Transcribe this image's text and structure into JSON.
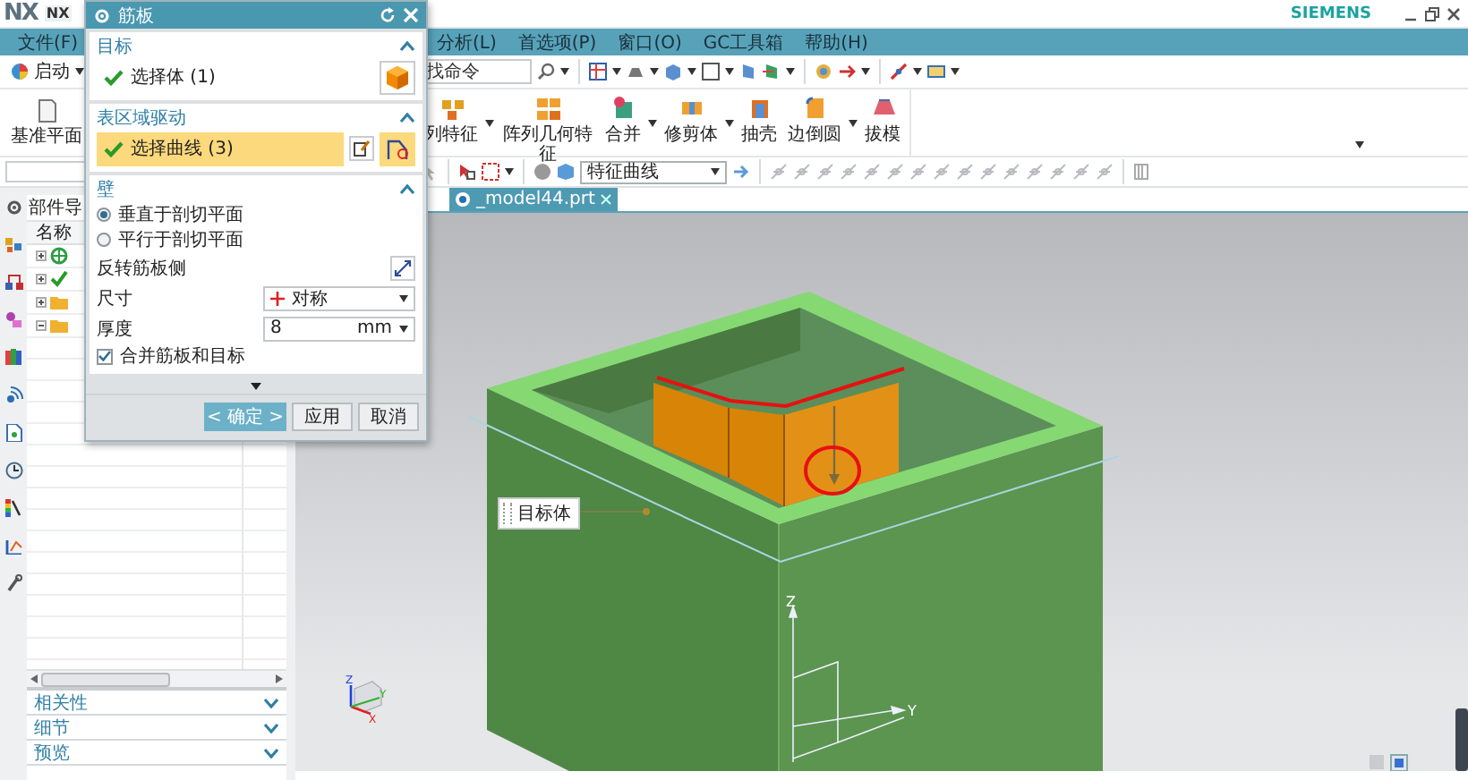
{
  "title_bar": {
    "logo": "NX",
    "app_name": "NX",
    "brand": "SIEMENS"
  },
  "menu_bar": {
    "left": [
      "文件(F)"
    ],
    "right": [
      "分析(L)",
      "首选项(P)",
      "窗口(O)",
      "GC工具箱",
      "帮助(H)"
    ]
  },
  "toolbar": {
    "start_menu": "启动",
    "command_search": {
      "placeholder": "找命令"
    }
  },
  "ribbon": {
    "datum_plane": "基准平面",
    "items": [
      {
        "label": "列特征",
        "dropdown": true
      },
      {
        "label": "阵列几何特征",
        "dropdown": false
      },
      {
        "label": "合并",
        "dropdown": true
      },
      {
        "label": "修剪体",
        "dropdown": true
      },
      {
        "label": "抽壳",
        "dropdown": false
      },
      {
        "label": "边倒圆",
        "dropdown": true
      },
      {
        "label": "拔模",
        "dropdown": false
      }
    ]
  },
  "selection_bar": {
    "filter": "特征曲线"
  },
  "tabs": [
    {
      "label": "_model44.prt",
      "selected": true
    }
  ],
  "navigator": {
    "title": "部件导",
    "column": "名称",
    "sections": [
      {
        "label": "相关性",
        "expanded": false
      },
      {
        "label": "细节",
        "expanded": false
      },
      {
        "label": "预览",
        "expanded": false
      }
    ]
  },
  "dialog": {
    "title": "筋板",
    "sections": [
      {
        "kind": "target",
        "title": "目标",
        "expanded": true,
        "selector": {
          "label": "选择体 (1)",
          "done": true,
          "selected": false
        }
      },
      {
        "kind": "curves",
        "title": "表区域驱动",
        "expanded": true,
        "selector": {
          "label": "选择曲线 (3)",
          "done": true,
          "selected": true
        }
      },
      {
        "kind": "wall",
        "title": "壁",
        "expanded": true,
        "options": [
          {
            "label": "垂直于剖切平面",
            "selected": true
          },
          {
            "label": "平行于剖切平面",
            "selected": false
          }
        ],
        "reverse_label": "反转筋板侧",
        "size": {
          "label": "尺寸",
          "value": "对称"
        },
        "thickness": {
          "label": "厚度",
          "value": "8",
          "unit": "mm"
        },
        "merge": {
          "label": "合并筋板和目标",
          "checked": true
        }
      }
    ],
    "buttons": [
      {
        "label": "< 确定 >",
        "kind": "primary"
      },
      {
        "label": "应用",
        "kind": "normal"
      },
      {
        "label": "取消",
        "kind": "normal"
      }
    ]
  },
  "viewport": {
    "callout": "目标体",
    "wcs": {
      "z": "Z",
      "y": "Y"
    },
    "triad": {
      "z": "Z",
      "y": "Y",
      "x": "X"
    }
  }
}
